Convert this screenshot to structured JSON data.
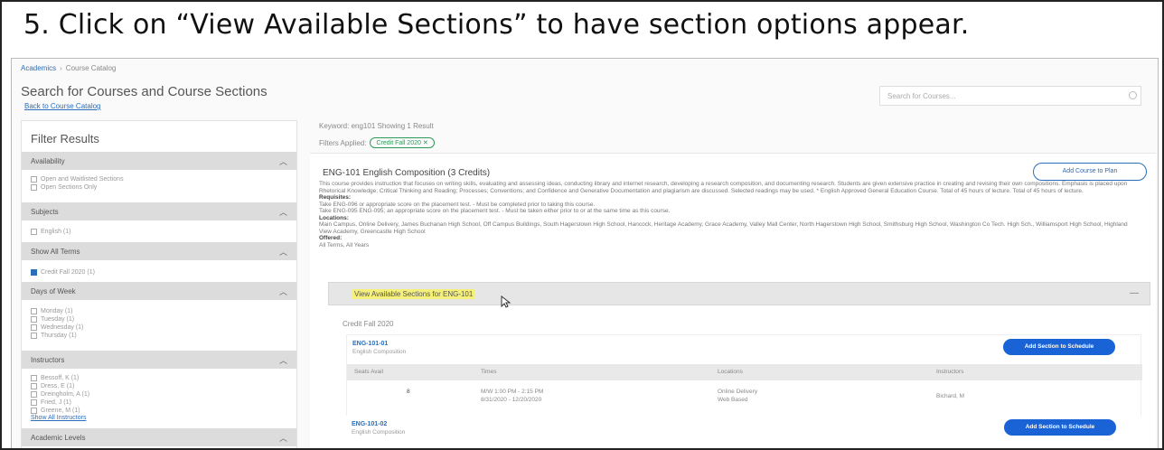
{
  "headline": "5. Click on “View Available Sections” to have section options appear.",
  "breadcrumb": {
    "home": "Academics",
    "current": "Course Catalog"
  },
  "page_title": "Search for Courses and Course Sections",
  "back_link": "Back to Course Catalog",
  "search": {
    "placeholder": "Search for Courses..."
  },
  "sidebar": {
    "title": "Filter Results",
    "groups": [
      {
        "label": "Availability",
        "options": [
          {
            "label": "Open and Waitlisted Sections",
            "checked": false
          },
          {
            "label": "Open Sections Only",
            "checked": false
          }
        ]
      },
      {
        "label": "Subjects",
        "options": [
          {
            "label": "English (1)",
            "checked": false
          }
        ]
      },
      {
        "label": "Show All Terms",
        "options": [
          {
            "label": "Credit Fall 2020 (1)",
            "checked": true
          }
        ]
      },
      {
        "label": "Days of Week",
        "options": [
          {
            "label": "Monday (1)",
            "checked": false
          },
          {
            "label": "Tuesday (1)",
            "checked": false
          },
          {
            "label": "Wednesday (1)",
            "checked": false
          },
          {
            "label": "Thursday (1)",
            "checked": false
          }
        ]
      },
      {
        "label": "Instructors",
        "options": [
          {
            "label": "Bessoff, K (1)",
            "checked": false
          },
          {
            "label": "Dress, E (1)",
            "checked": false
          },
          {
            "label": "Dreingholm, A (1)",
            "checked": false
          },
          {
            "label": "Fried, J (1)",
            "checked": false
          },
          {
            "label": "Greene, M (1)",
            "checked": false
          }
        ],
        "more_link": "Show All Instructors"
      },
      {
        "label": "Academic Levels",
        "options": []
      }
    ]
  },
  "results": {
    "count_text": "Keyword: eng101 Showing 1 Result",
    "filters_label": "Filters Applied:",
    "filter_chip": "Credit Fall 2020 ✕"
  },
  "course": {
    "title": "ENG-101 English Composition (3 Credits)",
    "add_button": "Add Course to Plan",
    "description": "This course provides instruction that focuses on writing skills, evaluating and assessing ideas, conducting library and internet research, developing a research composition, and documenting research. Students are given extensive practice in creating and revising their own compositions. Emphasis is placed upon Rhetorical Knowledge; Critical Thinking and Reading; Processes; Conventions; and Confidence and Generative Documentation and plagiarism are discussed. Selected readings may be used. * English Approved General Education Course. Total of 45 hours of lecture. Total of 45 hours of lecture.",
    "requisites_label": "Requisites:",
    "requisite_1": "Take ENG-096 or appropriate score on the placement test. - Must be completed prior to taking this course.",
    "requisite_2": "Take ENG-095 ENG-095; an appropriate score on the placement test. - Must be taken either prior to or at the same time as this course.",
    "locations_label": "Locations:",
    "locations": "Main Campus, Online Delivery, James Buchanan High School, Off Campus Buildings, South Hagerstown High School, Hancock, Heritage Academy, Grace Academy, Valley Mall Center, North Hagerstown High School, Smithsburg High School, Washington Co Tech. High Sch., Williamsport High School, Highland View Academy, Greencastle High School",
    "offered_label": "Offered:",
    "offered": "All Terms, All Years",
    "view_sections_link": "View Available Sections for ENG-101",
    "term_label": "Credit Fall 2020",
    "sections": [
      {
        "code": "ENG-101-01",
        "subtitle": "English Composition",
        "add_button": "Add Section to Schedule",
        "headers": [
          "Seats Avail",
          "Times",
          "Locations",
          "Instructors"
        ],
        "seats": "8",
        "times_1": "M/W 1:00 PM - 2:15 PM",
        "times_2": "8/31/2020 - 12/20/2020",
        "location_1": "Online Delivery",
        "location_2": "Web Based",
        "instructor": "Bichard, M"
      },
      {
        "code": "ENG-101-02",
        "subtitle": "English Composition",
        "add_button": "Add Section to Schedule"
      }
    ]
  },
  "colors": {
    "link": "#2a6ebb",
    "primary_button": "#1a63d6",
    "highlight": "#f5f07a",
    "chip": "#2e9a5a"
  }
}
